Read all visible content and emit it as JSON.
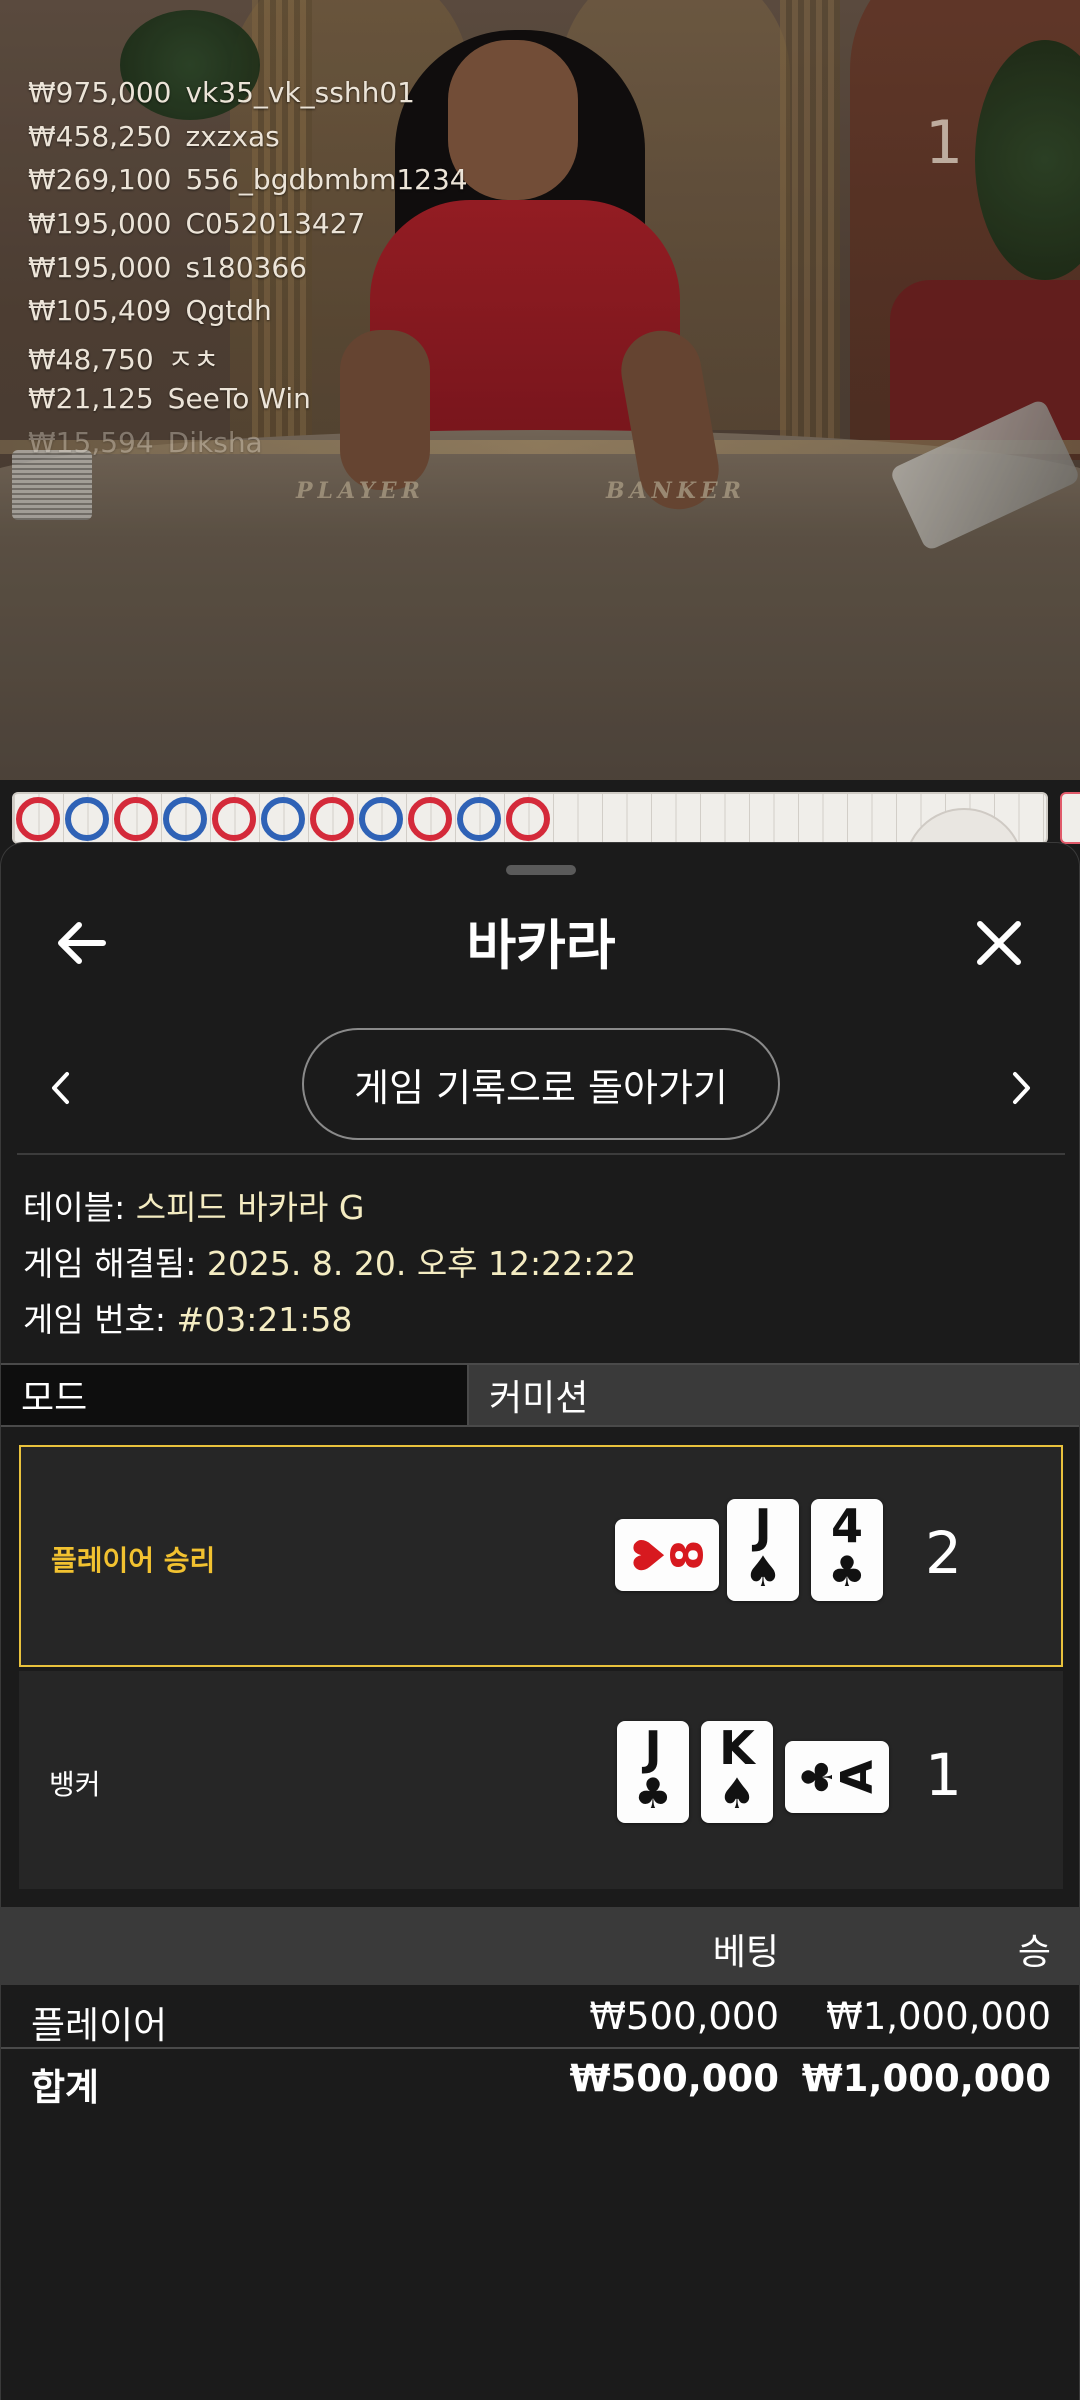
{
  "video": {
    "round_number": "1",
    "table_words": {
      "player": "PLAYER",
      "banker": "BANKER"
    },
    "winners": [
      {
        "amount": "₩975,000",
        "name": "vk35_vk_sshh01"
      },
      {
        "amount": "₩458,250",
        "name": "zxzxas"
      },
      {
        "amount": "₩269,100",
        "name": "556_bgdbmbm1234"
      },
      {
        "amount": "₩195,000",
        "name": "C052013427"
      },
      {
        "amount": "₩195,000",
        "name": "s180366"
      },
      {
        "amount": "₩105,409",
        "name": "Qgtdh"
      },
      {
        "amount": "₩48,750",
        "name": "ㅈㅊ"
      },
      {
        "amount": "₩21,125",
        "name": "SeeTo Win"
      },
      {
        "amount": "₩15,594",
        "name": "Diksha"
      }
    ]
  },
  "road": {
    "results": [
      "banker",
      "player",
      "banker",
      "player",
      "banker",
      "player",
      "banker",
      "player",
      "banker",
      "player",
      "banker"
    ],
    "colors": {
      "banker": "#d42a3a",
      "player": "#2f62b6"
    }
  },
  "sheet": {
    "title": "바카라",
    "icons": {
      "back": "arrow-left-icon",
      "close": "close-icon",
      "prev": "chevron-left-icon",
      "next": "chevron-right-icon"
    },
    "return_label": "게임 기록으로 돌아가기",
    "info": {
      "table_label": "테이블: ",
      "table_value": "스피드 바카라 G",
      "resolved_label": "게임 해결됨: ",
      "resolved_value": "2025. 8. 20. 오후 12:22:22",
      "number_label": "게임 번호: ",
      "number_value": "#03:21:58"
    },
    "tabs": {
      "mode": "모드",
      "commission": "커미션"
    },
    "player_result": {
      "label": "플레이어 승리",
      "score": "2",
      "cards": [
        {
          "rank": "8",
          "suit": "♥",
          "color": "red",
          "sideways": true
        },
        {
          "rank": "J",
          "suit": "♠",
          "color": "black",
          "sideways": false
        },
        {
          "rank": "4",
          "suit": "♣",
          "color": "black",
          "sideways": false
        }
      ]
    },
    "banker_result": {
      "label": "뱅커",
      "score": "1",
      "cards": [
        {
          "rank": "J",
          "suit": "♣",
          "color": "black",
          "sideways": false
        },
        {
          "rank": "K",
          "suit": "♠",
          "color": "black",
          "sideways": false
        },
        {
          "rank": "A",
          "suit": "♣",
          "color": "black",
          "sideways": true
        }
      ]
    },
    "bets": {
      "headers": {
        "bet": "베팅",
        "win": "승"
      },
      "player_row": {
        "label": "플레이어",
        "bet": "₩500,000",
        "win": "₩1,000,000"
      },
      "total_row": {
        "label": "합계",
        "bet": "₩500,000",
        "win": "₩1,000,000"
      }
    },
    "accent_color": "#e9c23d"
  }
}
